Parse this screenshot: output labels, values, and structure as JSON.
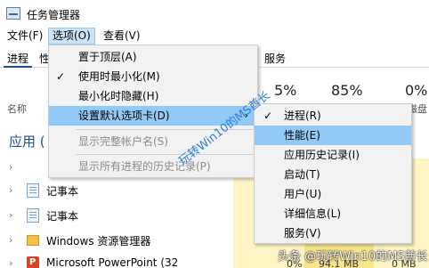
{
  "window": {
    "title": "任务管理器"
  },
  "menubar": {
    "file": "文件(F)",
    "options": "选项(O)",
    "view": "查看(V)"
  },
  "tabs": {
    "processes": "进程",
    "performance_partial": "性",
    "services": "服务"
  },
  "columns": {
    "name": "名称",
    "cpu_pct": "5%",
    "memory_pct": "85%",
    "disk_pct": "0%",
    "disk_partial": "磁盘"
  },
  "processes": {
    "section_title": "应用 (",
    "rows": [
      {
        "label": ""
      },
      {
        "label": "记事本"
      },
      {
        "label": "记事本"
      },
      {
        "label": "Windows 资源管理器"
      },
      {
        "label": "Microsoft PowerPoint (32"
      }
    ],
    "bottom_values": {
      "cpu": "0%",
      "memory": "94.1 MB",
      "disk": "0 MB"
    }
  },
  "options_menu": {
    "items": [
      {
        "label": "置于顶层(A)",
        "checked": false,
        "disabled": false
      },
      {
        "label": "使用时最小化(M)",
        "checked": true,
        "disabled": false
      },
      {
        "label": "最小化时隐藏(H)",
        "checked": false,
        "disabled": false
      },
      {
        "label": "设置默认选项卡(D)",
        "checked": false,
        "disabled": false,
        "submenu": true,
        "highlighted": true
      },
      {
        "label": "显示完整帐户名(S)",
        "checked": false,
        "disabled": true
      },
      {
        "label": "显示所有进程的历史记录(P)",
        "checked": false,
        "disabled": true
      }
    ],
    "check_glyph": "✓",
    "submenu_glyph": "›"
  },
  "default_tab_submenu": {
    "items": [
      {
        "label": "进程(R)",
        "checked": true
      },
      {
        "label": "性能(E)",
        "checked": false,
        "highlighted": true
      },
      {
        "label": "应用历史记录(I)",
        "checked": false
      },
      {
        "label": "启动(T)",
        "checked": false
      },
      {
        "label": "用户(U)",
        "checked": false
      },
      {
        "label": "详细信息(L)",
        "checked": false
      },
      {
        "label": "服务(V)",
        "checked": false
      }
    ]
  },
  "watermarks": {
    "diagonal": "玩转Win10的MS酋长",
    "bottom": "头条 @玩转Win10的MS酋长"
  },
  "colors": {
    "highlight": "#91c9f7",
    "menu_bg": "#f2f2f2",
    "section_blue": "#1e4e9c",
    "usage_yellow_light": "#fff4c4",
    "usage_yellow_dark": "#f9e58e"
  }
}
